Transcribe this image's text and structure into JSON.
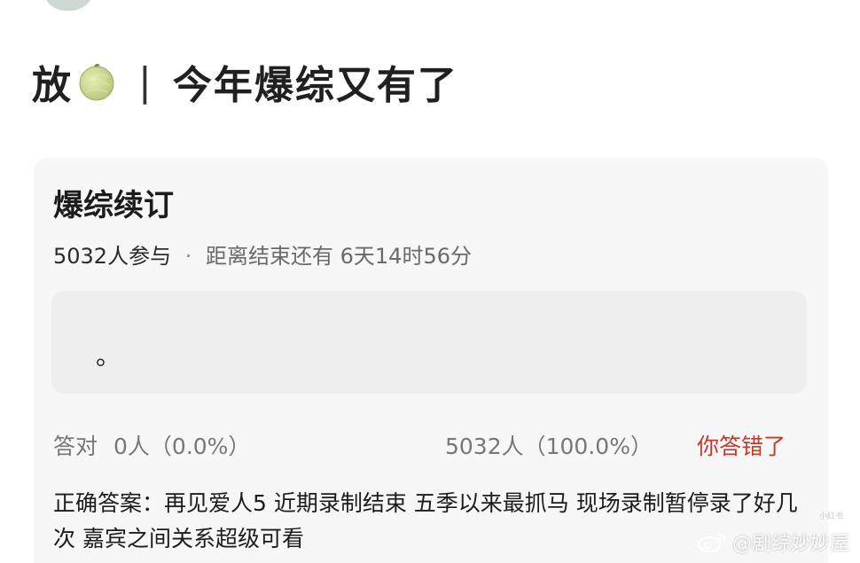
{
  "post": {
    "title_prefix": "放",
    "title_separator": "|",
    "title_text": "今年爆综又有了",
    "emoji": "melon-emoji"
  },
  "quiz": {
    "title": "爆综续订",
    "participants": "5032人参与",
    "separator": "·",
    "remaining_label": "距离结束还有",
    "remaining_time": "6天14时56分",
    "answer_text": "。",
    "correct_label": "答对",
    "correct_count": "0人（0.0%）",
    "wrong_count": "5032人（100.0%）",
    "wrong_result": "你答错了",
    "correct_answer": "正确答案：再见爱人5 近期录制结束 五季以来最抓马 现场录制暂停录了好几次 嘉宾之间关系超级可看"
  },
  "watermark": {
    "text": "@剧综妙妙屋",
    "icon": "weibo-icon",
    "small_mark": "小红书"
  },
  "colors": {
    "wrong_accent": "#c8382b",
    "card_background": "#f7f7f7",
    "answer_box_background": "#eeeeee"
  }
}
